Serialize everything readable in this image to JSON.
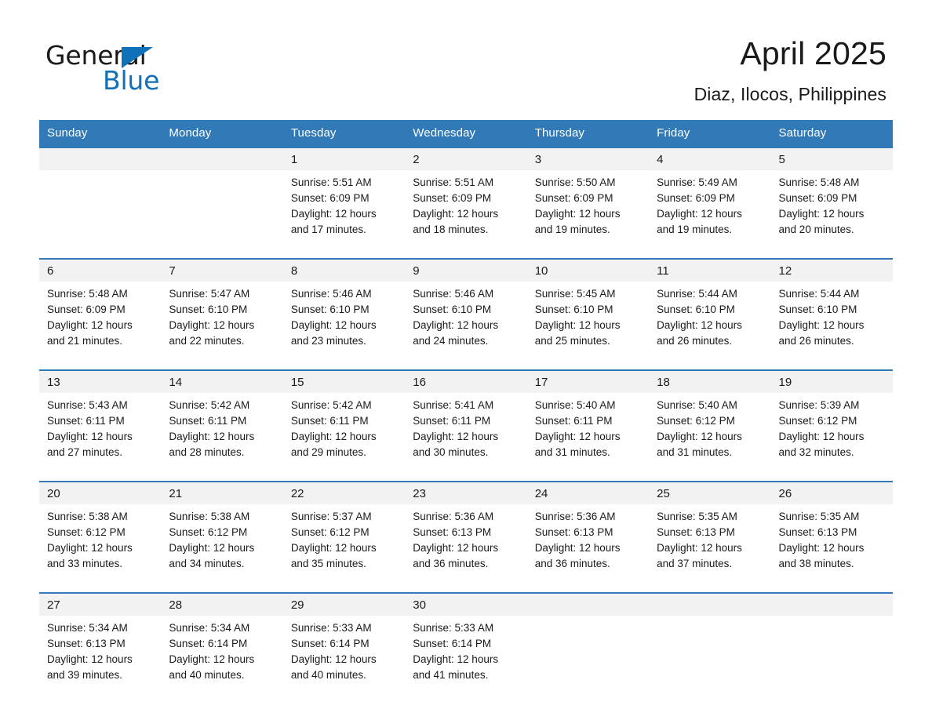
{
  "logo": {
    "word_one": "General",
    "word_two": "Blue",
    "triangle_icon": "triangle-icon",
    "brand_color": "#1071b8"
  },
  "header": {
    "month_title": "April 2025",
    "location": "Diaz, Ilocos, Philippines",
    "header_bg": "#3179b7",
    "daynum_bg": "#f2f2f2"
  },
  "weekday_headers": [
    "Sunday",
    "Monday",
    "Tuesday",
    "Wednesday",
    "Thursday",
    "Friday",
    "Saturday"
  ],
  "weeks": [
    {
      "daynums": [
        "",
        "",
        "1",
        "2",
        "3",
        "4",
        "5"
      ],
      "cells": [
        {
          "sunrise": "",
          "sunset": "",
          "daylight_1": "",
          "daylight_2": ""
        },
        {
          "sunrise": "",
          "sunset": "",
          "daylight_1": "",
          "daylight_2": ""
        },
        {
          "sunrise": "Sunrise: 5:51 AM",
          "sunset": "Sunset: 6:09 PM",
          "daylight_1": "Daylight: 12 hours",
          "daylight_2": "and 17 minutes."
        },
        {
          "sunrise": "Sunrise: 5:51 AM",
          "sunset": "Sunset: 6:09 PM",
          "daylight_1": "Daylight: 12 hours",
          "daylight_2": "and 18 minutes."
        },
        {
          "sunrise": "Sunrise: 5:50 AM",
          "sunset": "Sunset: 6:09 PM",
          "daylight_1": "Daylight: 12 hours",
          "daylight_2": "and 19 minutes."
        },
        {
          "sunrise": "Sunrise: 5:49 AM",
          "sunset": "Sunset: 6:09 PM",
          "daylight_1": "Daylight: 12 hours",
          "daylight_2": "and 19 minutes."
        },
        {
          "sunrise": "Sunrise: 5:48 AM",
          "sunset": "Sunset: 6:09 PM",
          "daylight_1": "Daylight: 12 hours",
          "daylight_2": "and 20 minutes."
        }
      ]
    },
    {
      "daynums": [
        "6",
        "7",
        "8",
        "9",
        "10",
        "11",
        "12"
      ],
      "cells": [
        {
          "sunrise": "Sunrise: 5:48 AM",
          "sunset": "Sunset: 6:09 PM",
          "daylight_1": "Daylight: 12 hours",
          "daylight_2": "and 21 minutes."
        },
        {
          "sunrise": "Sunrise: 5:47 AM",
          "sunset": "Sunset: 6:10 PM",
          "daylight_1": "Daylight: 12 hours",
          "daylight_2": "and 22 minutes."
        },
        {
          "sunrise": "Sunrise: 5:46 AM",
          "sunset": "Sunset: 6:10 PM",
          "daylight_1": "Daylight: 12 hours",
          "daylight_2": "and 23 minutes."
        },
        {
          "sunrise": "Sunrise: 5:46 AM",
          "sunset": "Sunset: 6:10 PM",
          "daylight_1": "Daylight: 12 hours",
          "daylight_2": "and 24 minutes."
        },
        {
          "sunrise": "Sunrise: 5:45 AM",
          "sunset": "Sunset: 6:10 PM",
          "daylight_1": "Daylight: 12 hours",
          "daylight_2": "and 25 minutes."
        },
        {
          "sunrise": "Sunrise: 5:44 AM",
          "sunset": "Sunset: 6:10 PM",
          "daylight_1": "Daylight: 12 hours",
          "daylight_2": "and 26 minutes."
        },
        {
          "sunrise": "Sunrise: 5:44 AM",
          "sunset": "Sunset: 6:10 PM",
          "daylight_1": "Daylight: 12 hours",
          "daylight_2": "and 26 minutes."
        }
      ]
    },
    {
      "daynums": [
        "13",
        "14",
        "15",
        "16",
        "17",
        "18",
        "19"
      ],
      "cells": [
        {
          "sunrise": "Sunrise: 5:43 AM",
          "sunset": "Sunset: 6:11 PM",
          "daylight_1": "Daylight: 12 hours",
          "daylight_2": "and 27 minutes."
        },
        {
          "sunrise": "Sunrise: 5:42 AM",
          "sunset": "Sunset: 6:11 PM",
          "daylight_1": "Daylight: 12 hours",
          "daylight_2": "and 28 minutes."
        },
        {
          "sunrise": "Sunrise: 5:42 AM",
          "sunset": "Sunset: 6:11 PM",
          "daylight_1": "Daylight: 12 hours",
          "daylight_2": "and 29 minutes."
        },
        {
          "sunrise": "Sunrise: 5:41 AM",
          "sunset": "Sunset: 6:11 PM",
          "daylight_1": "Daylight: 12 hours",
          "daylight_2": "and 30 minutes."
        },
        {
          "sunrise": "Sunrise: 5:40 AM",
          "sunset": "Sunset: 6:11 PM",
          "daylight_1": "Daylight: 12 hours",
          "daylight_2": "and 31 minutes."
        },
        {
          "sunrise": "Sunrise: 5:40 AM",
          "sunset": "Sunset: 6:12 PM",
          "daylight_1": "Daylight: 12 hours",
          "daylight_2": "and 31 minutes."
        },
        {
          "sunrise": "Sunrise: 5:39 AM",
          "sunset": "Sunset: 6:12 PM",
          "daylight_1": "Daylight: 12 hours",
          "daylight_2": "and 32 minutes."
        }
      ]
    },
    {
      "daynums": [
        "20",
        "21",
        "22",
        "23",
        "24",
        "25",
        "26"
      ],
      "cells": [
        {
          "sunrise": "Sunrise: 5:38 AM",
          "sunset": "Sunset: 6:12 PM",
          "daylight_1": "Daylight: 12 hours",
          "daylight_2": "and 33 minutes."
        },
        {
          "sunrise": "Sunrise: 5:38 AM",
          "sunset": "Sunset: 6:12 PM",
          "daylight_1": "Daylight: 12 hours",
          "daylight_2": "and 34 minutes."
        },
        {
          "sunrise": "Sunrise: 5:37 AM",
          "sunset": "Sunset: 6:12 PM",
          "daylight_1": "Daylight: 12 hours",
          "daylight_2": "and 35 minutes."
        },
        {
          "sunrise": "Sunrise: 5:36 AM",
          "sunset": "Sunset: 6:13 PM",
          "daylight_1": "Daylight: 12 hours",
          "daylight_2": "and 36 minutes."
        },
        {
          "sunrise": "Sunrise: 5:36 AM",
          "sunset": "Sunset: 6:13 PM",
          "daylight_1": "Daylight: 12 hours",
          "daylight_2": "and 36 minutes."
        },
        {
          "sunrise": "Sunrise: 5:35 AM",
          "sunset": "Sunset: 6:13 PM",
          "daylight_1": "Daylight: 12 hours",
          "daylight_2": "and 37 minutes."
        },
        {
          "sunrise": "Sunrise: 5:35 AM",
          "sunset": "Sunset: 6:13 PM",
          "daylight_1": "Daylight: 12 hours",
          "daylight_2": "and 38 minutes."
        }
      ]
    },
    {
      "daynums": [
        "27",
        "28",
        "29",
        "30",
        "",
        "",
        ""
      ],
      "cells": [
        {
          "sunrise": "Sunrise: 5:34 AM",
          "sunset": "Sunset: 6:13 PM",
          "daylight_1": "Daylight: 12 hours",
          "daylight_2": "and 39 minutes."
        },
        {
          "sunrise": "Sunrise: 5:34 AM",
          "sunset": "Sunset: 6:14 PM",
          "daylight_1": "Daylight: 12 hours",
          "daylight_2": "and 40 minutes."
        },
        {
          "sunrise": "Sunrise: 5:33 AM",
          "sunset": "Sunset: 6:14 PM",
          "daylight_1": "Daylight: 12 hours",
          "daylight_2": "and 40 minutes."
        },
        {
          "sunrise": "Sunrise: 5:33 AM",
          "sunset": "Sunset: 6:14 PM",
          "daylight_1": "Daylight: 12 hours",
          "daylight_2": "and 41 minutes."
        },
        {
          "sunrise": "",
          "sunset": "",
          "daylight_1": "",
          "daylight_2": ""
        },
        {
          "sunrise": "",
          "sunset": "",
          "daylight_1": "",
          "daylight_2": ""
        },
        {
          "sunrise": "",
          "sunset": "",
          "daylight_1": "",
          "daylight_2": ""
        }
      ]
    }
  ]
}
